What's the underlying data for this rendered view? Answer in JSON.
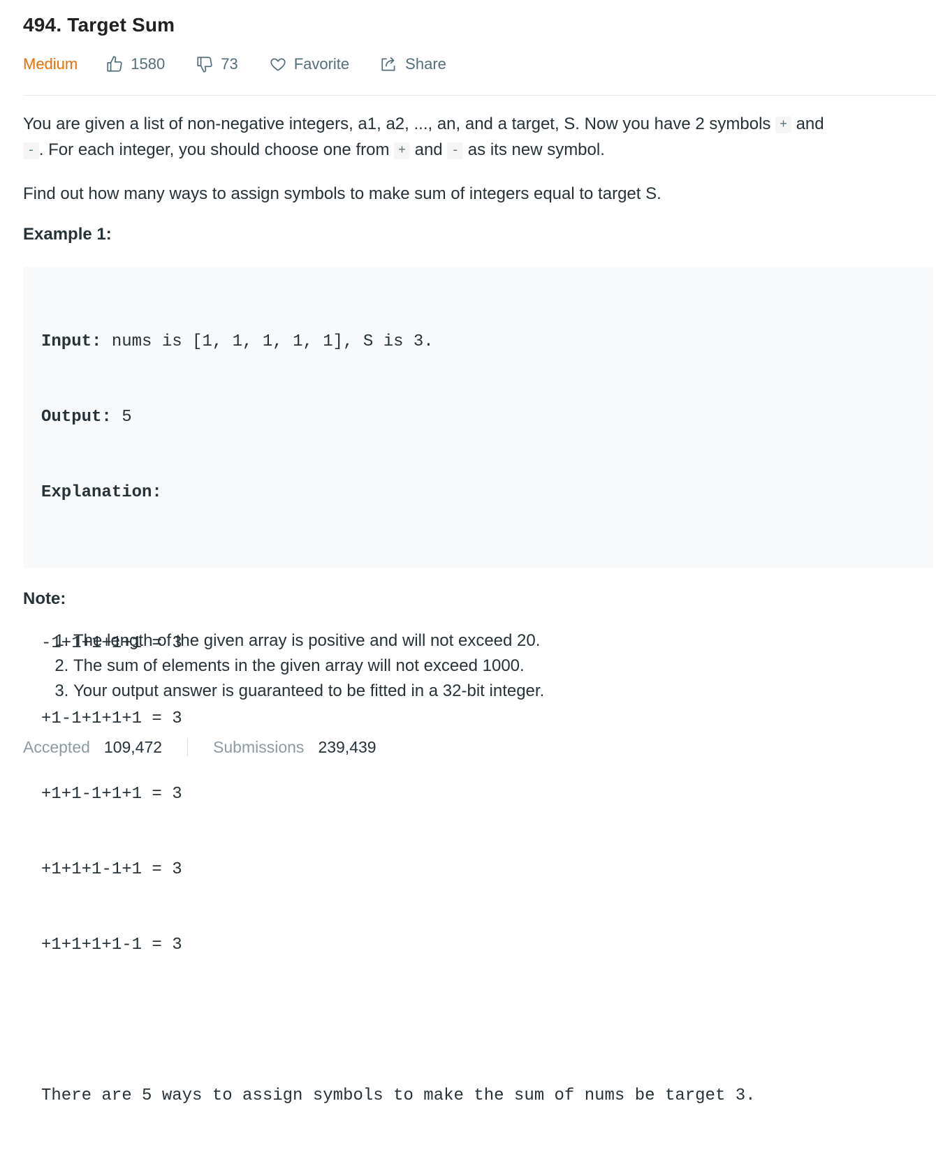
{
  "problem": {
    "title": "494. Target Sum",
    "difficulty": "Medium",
    "likes": "1580",
    "dislikes": "73",
    "favorite_label": "Favorite",
    "share_label": "Share"
  },
  "description": {
    "p1_a": "You are given a list of non-negative integers, a1, a2, ..., an, and a target, S. Now you have 2 symbols ",
    "plus": "+",
    "and": " and ",
    "minus": "-",
    "p1_b": ". For each integer, you should choose one from ",
    "p1_c": " as its new symbol.",
    "p2": "Find out how many ways to assign symbols to make sum of integers equal to target S."
  },
  "example": {
    "title": "Example 1:",
    "input_label": "Input:",
    "input_value": " nums is [1, 1, 1, 1, 1], S is 3.",
    "output_label": "Output:",
    "output_value": " 5",
    "explanation_label": "Explanation:",
    "lines": [
      "-1+1+1+1+1 = 3",
      "+1-1+1+1+1 = 3",
      "+1+1-1+1+1 = 3",
      "+1+1+1-1+1 = 3",
      "+1+1+1+1-1 = 3"
    ],
    "summary": "There are 5 ways to assign symbols to make the sum of nums be target 3."
  },
  "note": {
    "title": "Note:",
    "items": [
      "The length of the given array is positive and will not exceed 20.",
      "The sum of elements in the given array will not exceed 1000.",
      "Your output answer is guaranteed to be fitted in a 32-bit integer."
    ]
  },
  "stats": {
    "accepted_label": "Accepted",
    "accepted_value": "109,472",
    "submissions_label": "Submissions",
    "submissions_value": "239,439"
  },
  "colors": {
    "difficulty": "#ef6c00",
    "text": "#263238",
    "muted": "#546e7a"
  }
}
